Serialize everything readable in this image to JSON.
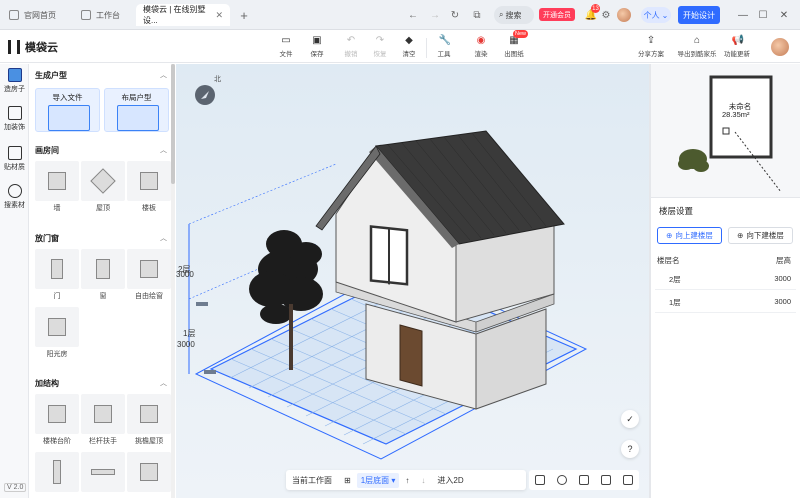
{
  "titlebar": {
    "tabs": [
      {
        "label": "官网首页",
        "active": false
      },
      {
        "label": "工作台",
        "active": false
      },
      {
        "label": "模袋云 | 在线别墅设...",
        "active": true
      }
    ],
    "search_label": "搜索",
    "vip_label": "开通会员",
    "notification_count": "13",
    "personal_label": "个人",
    "start_label": "开始设计"
  },
  "toolbar": {
    "logo_text": "模袋云",
    "tools": [
      {
        "label": "文件",
        "icon": "folder-icon",
        "enabled": true
      },
      {
        "label": "保存",
        "icon": "save-icon",
        "enabled": true
      },
      {
        "label": "撤销",
        "icon": "undo-icon",
        "enabled": false
      },
      {
        "label": "恢复",
        "icon": "redo-icon",
        "enabled": false
      },
      {
        "label": "清空",
        "icon": "eraser-icon",
        "enabled": true
      },
      {
        "label": "工具",
        "icon": "wrench-icon",
        "enabled": true
      },
      {
        "label": "渲染",
        "icon": "camera-icon",
        "enabled": true
      },
      {
        "label": "出图纸",
        "icon": "drawing-icon",
        "enabled": true
      }
    ],
    "new_badge": "New",
    "right_tools": [
      {
        "label": "分享方案",
        "icon": "share-icon"
      },
      {
        "label": "导出到酷家乐",
        "icon": "export-icon"
      },
      {
        "label": "功能更新",
        "icon": "megaphone-icon"
      }
    ]
  },
  "rail": {
    "items": [
      {
        "label": "造房子",
        "icon": "house-icon"
      },
      {
        "label": "加装饰",
        "icon": "decor-icon"
      },
      {
        "label": "贴材质",
        "icon": "material-icon"
      },
      {
        "label": "搜素材",
        "icon": "search-material-icon"
      }
    ],
    "version": "V 2.0"
  },
  "panel": {
    "generate": {
      "title": "生成户型",
      "cards": [
        {
          "label": "导入文件"
        },
        {
          "label": "布局户型"
        }
      ]
    },
    "draw_room": {
      "title": "画房间",
      "items": [
        {
          "label": "墙"
        },
        {
          "label": "屋顶"
        },
        {
          "label": "楼板"
        }
      ]
    },
    "doors_windows": {
      "title": "放门窗",
      "items": [
        {
          "label": "门"
        },
        {
          "label": "窗"
        },
        {
          "label": "自由绘窗"
        },
        {
          "label": "阳光房"
        }
      ]
    },
    "structures": {
      "title": "加结构",
      "items": [
        {
          "label": "楼梯台阶"
        },
        {
          "label": "栏杆扶手"
        },
        {
          "label": "挑檐屋顶"
        }
      ]
    }
  },
  "viewport": {
    "compass_label": "北",
    "dim_labels": {
      "floor1": "1层",
      "floor1_height": "3000",
      "floor2": "2层",
      "floor2_height": "3000"
    },
    "bottom_bar": {
      "current_plane": "当前工作面",
      "floor_select": "1层底面",
      "enter_2d": "进入2D"
    },
    "help_label": "?"
  },
  "minimap": {
    "room_name": "未命名",
    "room_area": "28.35m²"
  },
  "floor_panel": {
    "title": "楼层设置",
    "add_up": "向上建楼层",
    "add_down": "向下建楼层",
    "col_name": "楼层名",
    "col_height": "层高",
    "rows": [
      {
        "name": "2层",
        "height": "3000"
      },
      {
        "name": "1层",
        "height": "3000"
      }
    ]
  }
}
